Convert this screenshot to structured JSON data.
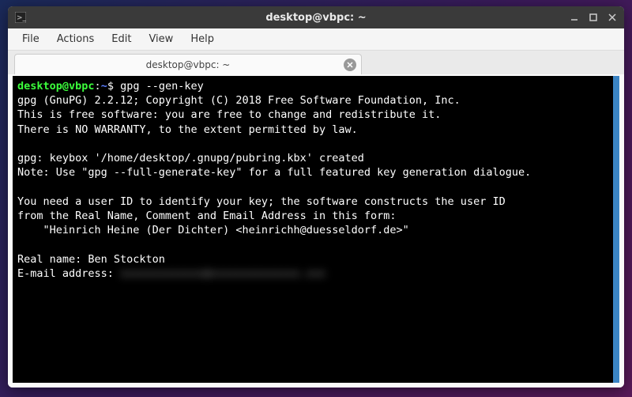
{
  "titlebar": {
    "title": "desktop@vbpc: ~"
  },
  "menu": {
    "file": "File",
    "actions": "Actions",
    "edit": "Edit",
    "view": "View",
    "help": "Help"
  },
  "tab": {
    "label": "desktop@vbpc: ~"
  },
  "prompt": {
    "user_host": "desktop@vbpc",
    "colon": ":",
    "path": "~",
    "dollar": "$"
  },
  "terminal": {
    "command": "gpg --gen-key",
    "l1": "gpg (GnuPG) 2.2.12; Copyright (C) 2018 Free Software Foundation, Inc.",
    "l2": "This is free software: you are free to change and redistribute it.",
    "l3": "There is NO WARRANTY, to the extent permitted by law.",
    "l4": "",
    "l5": "gpg: keybox '/home/desktop/.gnupg/pubring.kbx' created",
    "l6": "Note: Use \"gpg --full-generate-key\" for a full featured key generation dialogue.",
    "l7": "",
    "l8": "You need a user ID to identify your key; the software constructs the user ID",
    "l9": "from the Real Name, Comment and Email Address in this form:",
    "l10": "    \"Heinrich Heine (Der Dichter) <heinrichh@duesseldorf.de>\"",
    "l11": "",
    "realname_label": "Real name: ",
    "realname_value": "Ben Stockton",
    "email_label": "E-mail address: ",
    "email_redacted": "xxxxxxxxxxxxx@xxxxxxxxxxxxxx.xxx"
  }
}
